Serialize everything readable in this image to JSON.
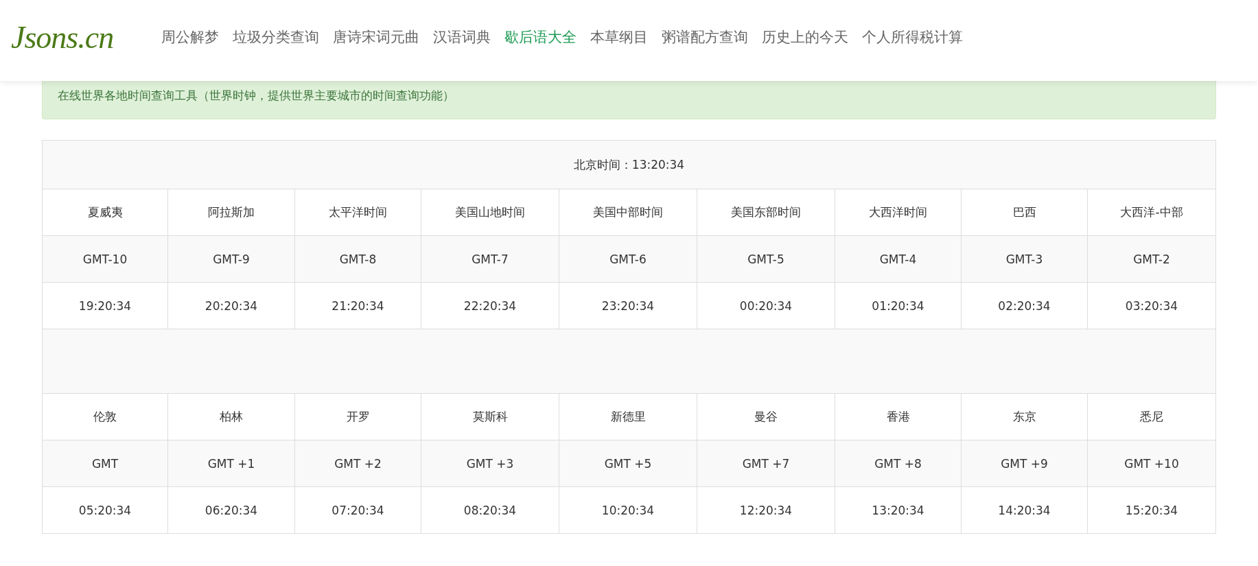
{
  "logo": "Jsons.cn",
  "nav": [
    {
      "label": "周公解梦",
      "selected": false
    },
    {
      "label": "垃圾分类查询",
      "selected": false
    },
    {
      "label": "唐诗宋词元曲",
      "selected": false
    },
    {
      "label": "汉语词典",
      "selected": false
    },
    {
      "label": "歇后语大全",
      "selected": true
    },
    {
      "label": "本草纲目",
      "selected": false
    },
    {
      "label": "粥谱配方查询",
      "selected": false
    },
    {
      "label": "历史上的今天",
      "selected": false
    },
    {
      "label": "个人所得税计算",
      "selected": false
    }
  ],
  "notice": "在线世界各地时间查询工具（世界时钟，提供世界主要城市的时间查询功能）",
  "table": {
    "caption": "北京时间：13:20:34",
    "groups": [
      {
        "cities": [
          {
            "name": "夏威夷",
            "offset": "GMT-10",
            "time": "19:20:34"
          },
          {
            "name": "阿拉斯加",
            "offset": "GMT-9",
            "time": "20:20:34"
          },
          {
            "name": "太平洋时间",
            "offset": "GMT-8",
            "time": "21:20:34"
          },
          {
            "name": "美国山地时间",
            "offset": "GMT-7",
            "time": "22:20:34"
          },
          {
            "name": "美国中部时间",
            "offset": "GMT-6",
            "time": "23:20:34"
          },
          {
            "name": "美国东部时间",
            "offset": "GMT-5",
            "time": "00:20:34"
          },
          {
            "name": "大西洋时间",
            "offset": "GMT-4",
            "time": "01:20:34"
          },
          {
            "name": "巴西",
            "offset": "GMT-3",
            "time": "02:20:34"
          },
          {
            "name": "大西洋-中部",
            "offset": "GMT-2",
            "time": "03:20:34"
          }
        ]
      },
      {
        "cities": [
          {
            "name": "伦敦",
            "offset": "GMT",
            "time": "05:20:34"
          },
          {
            "name": "柏林",
            "offset": "GMT +1",
            "time": "06:20:34"
          },
          {
            "name": "开罗",
            "offset": "GMT +2",
            "time": "07:20:34"
          },
          {
            "name": "莫斯科",
            "offset": "GMT +3",
            "time": "08:20:34"
          },
          {
            "name": "新德里",
            "offset": "GMT +5",
            "time": "10:20:34"
          },
          {
            "name": "曼谷",
            "offset": "GMT +7",
            "time": "12:20:34"
          },
          {
            "name": "香港",
            "offset": "GMT +8",
            "time": "13:20:34"
          },
          {
            "name": "东京",
            "offset": "GMT +9",
            "time": "14:20:34"
          },
          {
            "name": "悉尼",
            "offset": "GMT +10",
            "time": "15:20:34"
          }
        ]
      }
    ]
  }
}
